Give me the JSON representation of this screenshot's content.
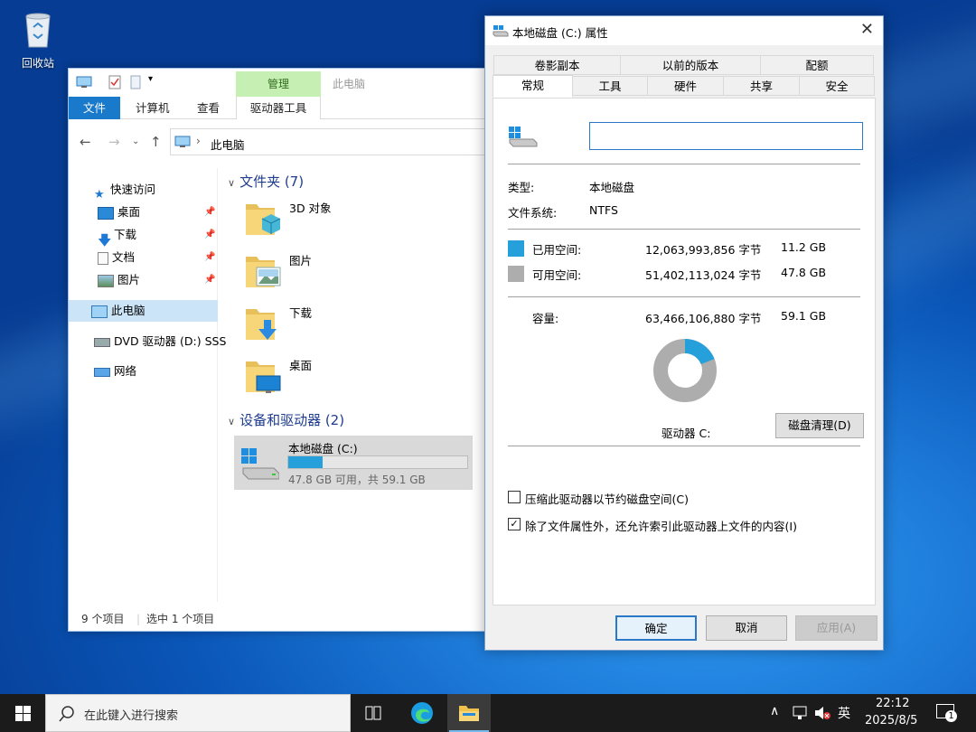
{
  "desktop": {
    "recycle_bin_label": "回收站"
  },
  "explorer": {
    "window_title": "此电脑",
    "context_tab": "管理",
    "ribbon_tabs": {
      "file": "文件",
      "computer": "计算机",
      "view": "查看",
      "drive_tools": "驱动器工具"
    },
    "address": "此电脑",
    "nav": {
      "quick_access": "快速访问",
      "desktop": "桌面",
      "downloads": "下载",
      "documents": "文档",
      "pictures": "图片",
      "this_pc": "此电脑",
      "dvd": "DVD 驱动器 (D:) SSS",
      "network": "网络"
    },
    "groups": {
      "folders": "文件夹 (7)",
      "devices": "设备和驱动器 (2)"
    },
    "folders": [
      "3D 对象",
      "图片",
      "下载",
      "桌面"
    ],
    "drive": {
      "name": "本地磁盘 (C:)",
      "space_text": "47.8 GB 可用，共 59.1 GB",
      "used_fraction": 0.19
    },
    "status": {
      "items": "9 个项目",
      "selected": "选中 1 个项目"
    }
  },
  "properties": {
    "title": "本地磁盘 (C:) 属性",
    "tabs_row1": [
      "卷影副本",
      "以前的版本",
      "配额"
    ],
    "tabs_row2": [
      "常规",
      "工具",
      "硬件",
      "共享",
      "安全"
    ],
    "volume_label_value": "",
    "type_label": "类型:",
    "type_value": "本地磁盘",
    "fs_label": "文件系统:",
    "fs_value": "NTFS",
    "used_label": "已用空间:",
    "used_bytes": "12,063,993,856 字节",
    "used_size": "11.2 GB",
    "free_label": "可用空间:",
    "free_bytes": "51,402,113,024 字节",
    "free_size": "47.8 GB",
    "capacity_label": "容量:",
    "capacity_bytes": "63,466,106,880 字节",
    "capacity_size": "59.1 GB",
    "used_fraction": 0.19,
    "drive_label": "驱动器 C:",
    "cleanup_button": "磁盘清理(D)",
    "compress_option": "压缩此驱动器以节约磁盘空间(C)",
    "compress_checked": false,
    "index_option": "除了文件属性外，还允许索引此驱动器上文件的内容(I)",
    "index_checked": true,
    "ok": "确定",
    "cancel": "取消",
    "apply": "应用(A)",
    "colors": {
      "used": "#26a0da",
      "free": "#adadad"
    }
  },
  "taskbar": {
    "search_placeholder": "在此键入进行搜索",
    "ime": "英",
    "time": "22:12",
    "date": "2025/8/5",
    "notification_count": "1"
  }
}
